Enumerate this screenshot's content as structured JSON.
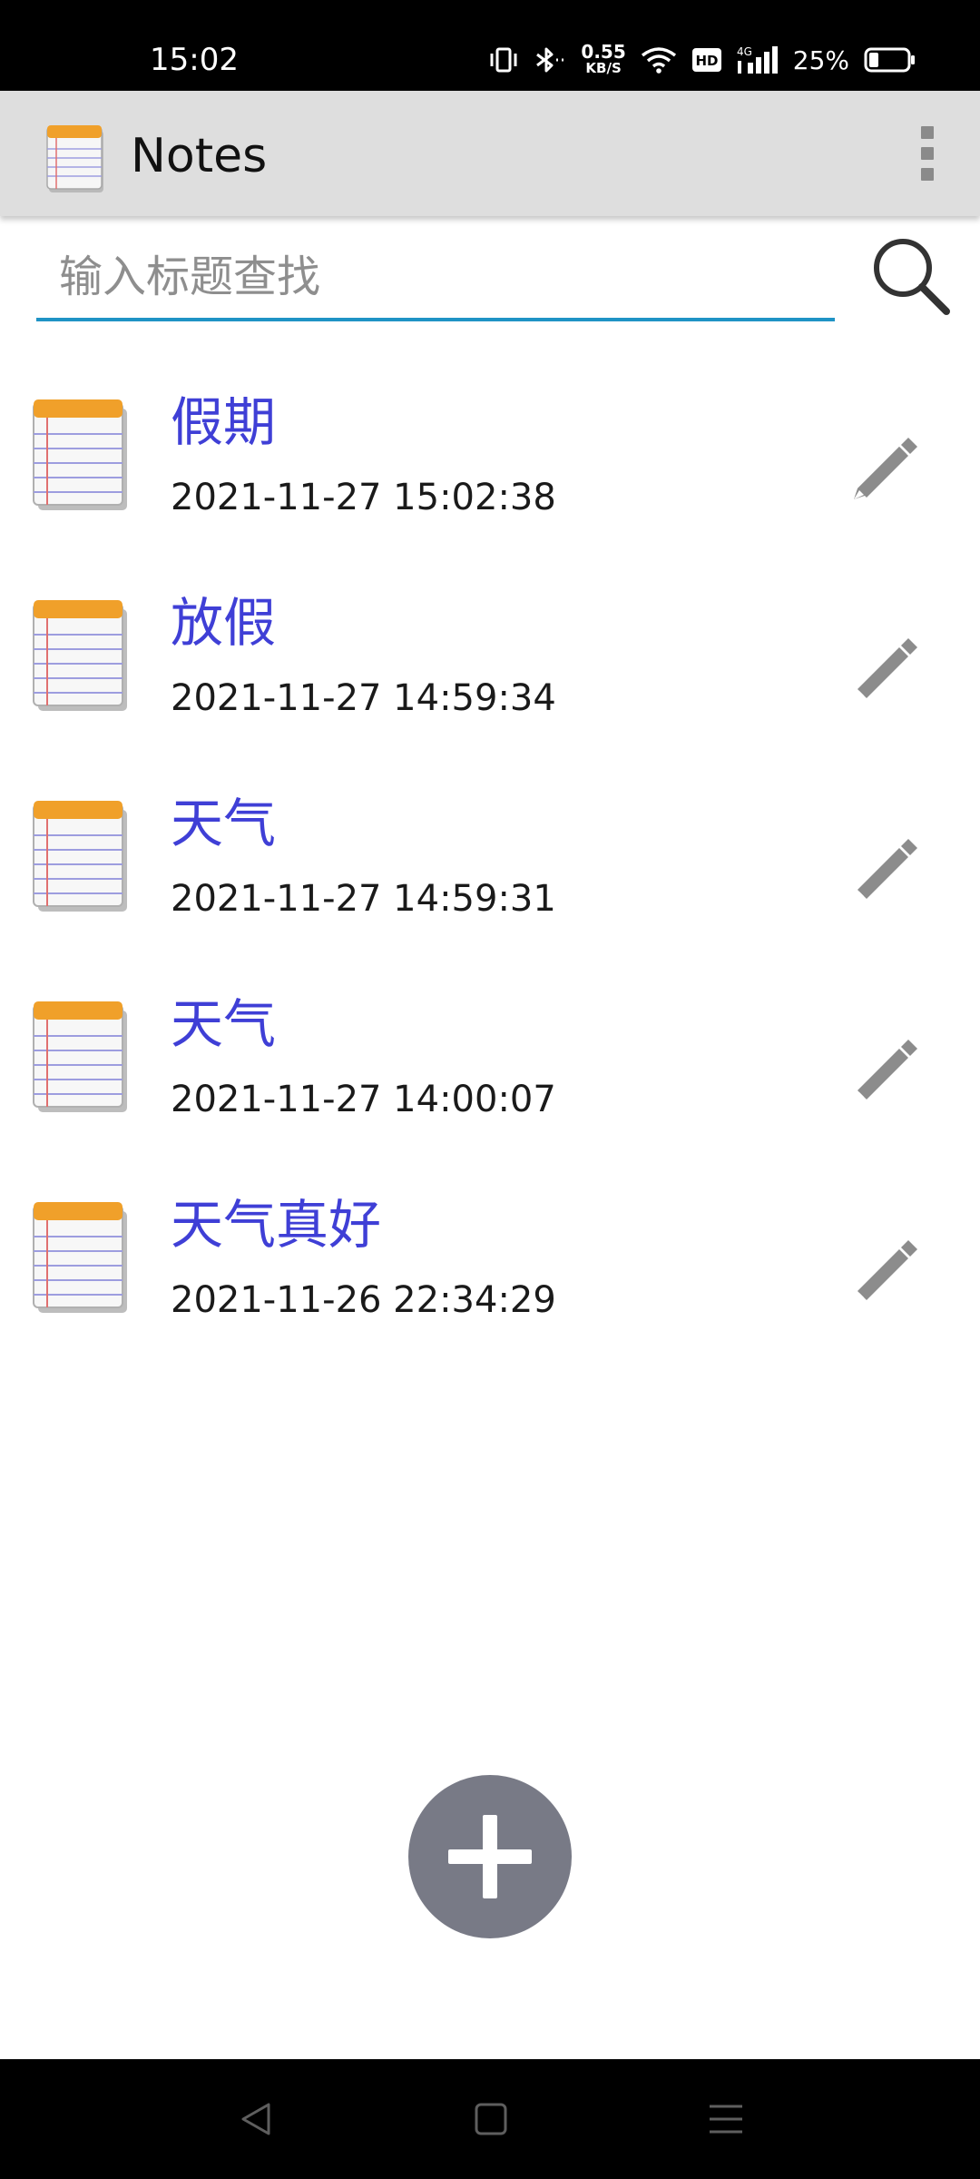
{
  "status_bar": {
    "time": "15:02",
    "net_speed_value": "0.55",
    "net_speed_unit": "KB/S",
    "hd_label": "HD",
    "network_type": "4G",
    "battery_percent": "25%",
    "battery_level": 0.25,
    "icons": [
      "vibrate-icon",
      "bluetooth-icon",
      "wifi-icon",
      "hd-icon",
      "signal-icon",
      "battery-icon"
    ]
  },
  "app_bar": {
    "title": "Notes",
    "logo_icon": "notepad-icon",
    "menu_icon": "overflow-menu-icon"
  },
  "search": {
    "placeholder": "输入标题查找",
    "value": "",
    "icon": "search-icon"
  },
  "notes": [
    {
      "title": "假期",
      "date": "2021-11-27 15:02:38"
    },
    {
      "title": "放假",
      "date": "2021-11-27 14:59:34"
    },
    {
      "title": "天气",
      "date": "2021-11-27 14:59:31"
    },
    {
      "title": "天气",
      "date": "2021-11-27 14:00:07"
    },
    {
      "title": "天气真好",
      "date": "2021-11-26 22:34:29"
    }
  ],
  "fab": {
    "icon": "plus-icon"
  },
  "nav_bar": {
    "icons": [
      "back-icon",
      "home-icon",
      "recents-icon"
    ]
  },
  "colors": {
    "accent": "#1f93c5",
    "note_title": "#3f3fd6",
    "fab": "#787a86",
    "app_bar": "#dedede"
  }
}
